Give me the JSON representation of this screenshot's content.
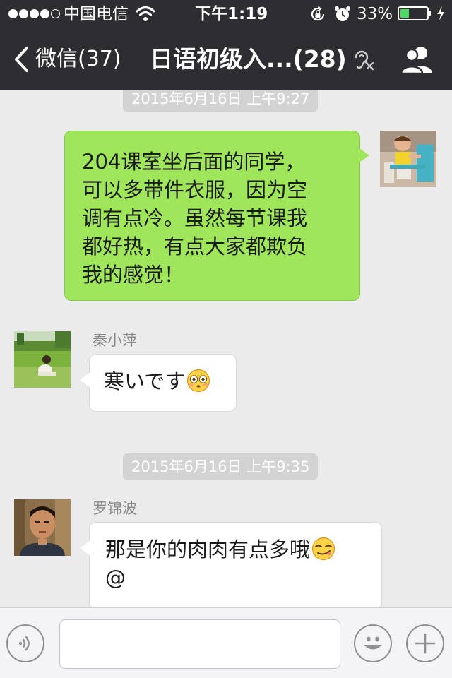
{
  "status_bar": {
    "carrier": "中国电信",
    "time": "下午1:19",
    "battery_percent": "33%",
    "battery_level": 0.33,
    "signal_bars": 4,
    "signal_max": 5,
    "battery_color": "#4cd964"
  },
  "nav": {
    "back_label": "微信(37)",
    "title": "日语初级入...(28)",
    "icons": [
      "chevron-left-icon",
      "earpiece-muted-icon",
      "group-members-icon"
    ]
  },
  "messages": [
    {
      "type": "timestamp",
      "text": "2015年6月16日 上午9:27"
    },
    {
      "type": "outgoing",
      "lines": [
        "204课室坐后面的同学，",
        "可以多带件衣服，因为空",
        "调有点冷。虽然每节课我",
        "都好热，有点大家都欺负",
        "我的感觉！"
      ],
      "bubble_color": "#9fe65a"
    },
    {
      "type": "incoming",
      "sender": "秦小萍",
      "lines": [
        "寒いです"
      ],
      "emoji": "flushed-face-emoji"
    },
    {
      "type": "timestamp",
      "text": "2015年6月16日 上午9:35"
    },
    {
      "type": "incoming",
      "sender": "罗锦波",
      "lines": [
        "那是你的肉肉有点多哦",
        "@"
      ],
      "emoji": "smirking-face-emoji"
    }
  ],
  "input_bar": {
    "value": "",
    "icons": [
      "voice-input-icon",
      "emoji-face-icon",
      "plus-icon"
    ]
  },
  "colors": {
    "nav_background": "#2d2d32",
    "chat_background": "#ebebeb",
    "timestamp_background": "#d3d3d3"
  }
}
